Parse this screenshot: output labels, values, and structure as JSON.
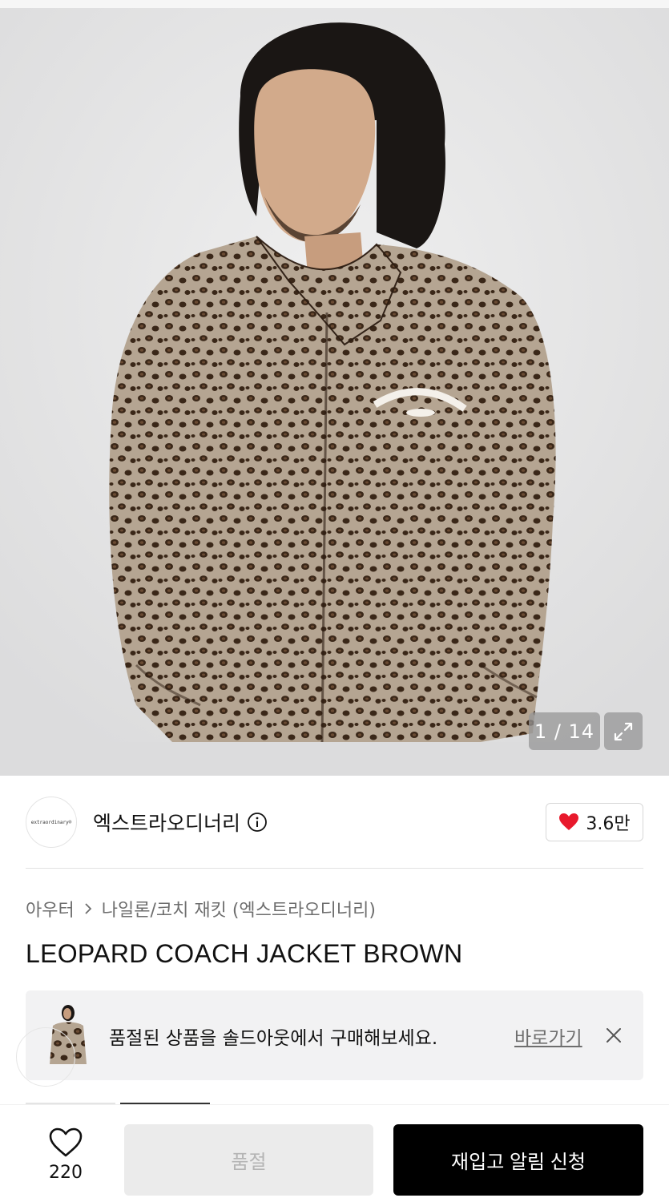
{
  "gallery": {
    "current": "1 / 14",
    "expand_icon": "expand-icon"
  },
  "brand": {
    "logo_text": "extraordinary®",
    "name": "엑스트라오디너리",
    "info_icon": "info-icon",
    "likes": "3.6만",
    "like_icon": "heart-filled-icon",
    "like_color": "#e8192c"
  },
  "breadcrumb": {
    "level1": "아우터",
    "level2": "나일론/코치 재킷 (엑스트라오디너리)"
  },
  "product": {
    "title": "LEOPARD COACH JACKET BROWN"
  },
  "soldout_banner": {
    "message": "품절된 상품을 솔드아웃에서 구매해보세요.",
    "link": "바로가기",
    "close_icon": "close-icon"
  },
  "bottom_bar": {
    "wish_icon": "heart-outline-icon",
    "wish_count": "220",
    "soldout_label": "품절",
    "restock_label": "재입고 알림 신청"
  }
}
